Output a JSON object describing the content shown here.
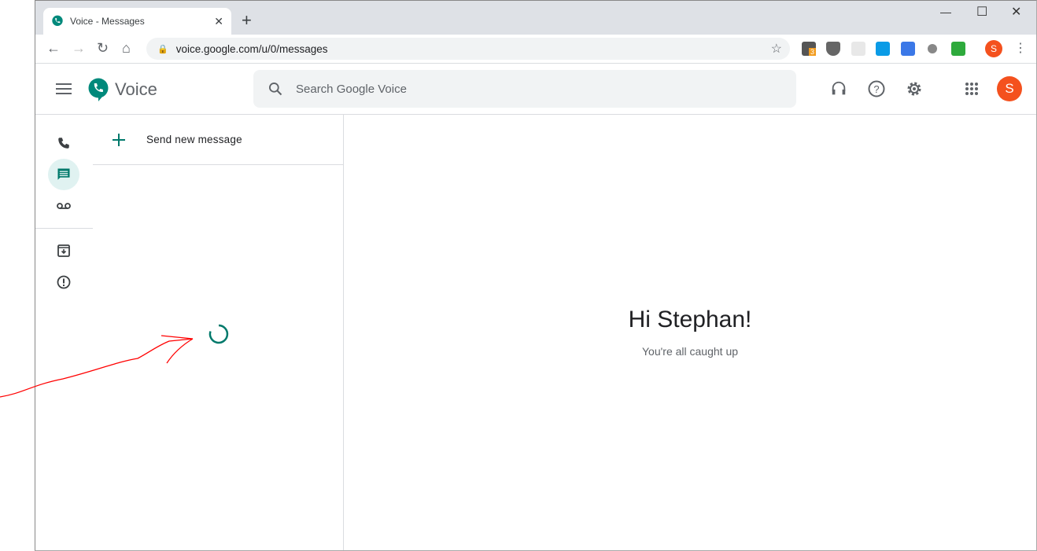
{
  "browser": {
    "tab_title": "Voice - Messages",
    "url": "voice.google.com/u/0/messages",
    "extension_badge": "3",
    "profile_initial": "S"
  },
  "app": {
    "name": "Voice",
    "search_placeholder": "Search Google Voice",
    "avatar_initial": "S",
    "accent": "#00796b"
  },
  "list": {
    "send_new_label": "Send new message"
  },
  "main": {
    "greeting": "Hi Stephan!",
    "status": "You're all caught up"
  }
}
